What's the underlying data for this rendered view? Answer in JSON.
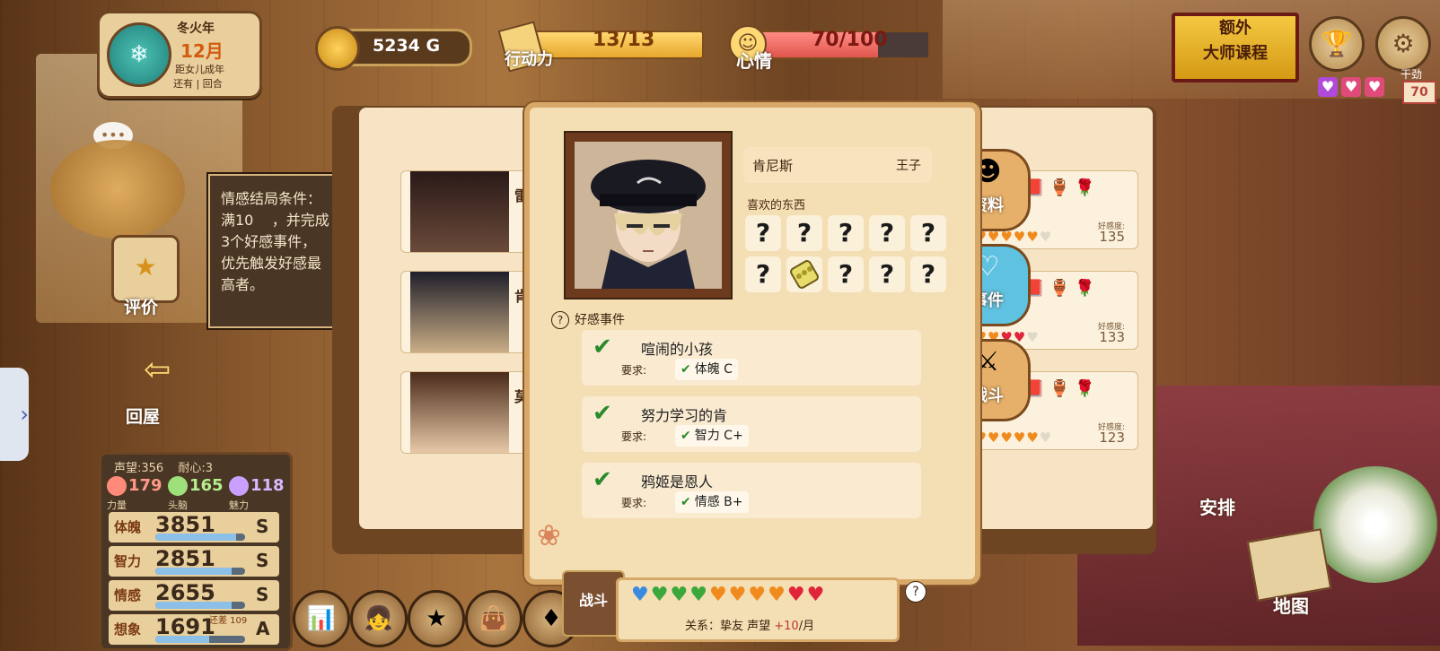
{
  "top": {
    "date": {
      "year": "冬火年",
      "month": "12月",
      "sub1": "距女儿成年",
      "sub2": "还有 | 回合"
    },
    "gold": "5234 G",
    "action_points": {
      "value": "13/13",
      "label": "行动力",
      "fraction": 1.0
    },
    "mood": {
      "value": "70/100",
      "label": "心情",
      "fraction": 0.7
    },
    "course_button": {
      "line1": "额外",
      "line2": "大师课程"
    },
    "interventions": {
      "label": "干劲",
      "value": "70"
    }
  },
  "left": {
    "eval_label": "评价",
    "back_label": "回屋",
    "tooltip": "情感结局条件：\n满10    ，并完成\n3个好感事件，\n优先触发好感最\n高者。"
  },
  "stats": {
    "reputation": "声望:356",
    "patience": "耐心:3",
    "core": [
      {
        "label": "力量",
        "value": "179",
        "color": "#ff8a7a"
      },
      {
        "label": "头脑",
        "value": "165",
        "color": "#9ee07a"
      },
      {
        "label": "魅力",
        "value": "118",
        "color": "#c9a0ff"
      }
    ],
    "attributes": [
      {
        "name": "体魄",
        "value": "3851",
        "grade": "S",
        "fill": 0.9,
        "extra": ""
      },
      {
        "name": "智力",
        "value": "2851",
        "grade": "S",
        "fill": 0.85,
        "extra": ""
      },
      {
        "name": "情感",
        "value": "2655",
        "grade": "S",
        "fill": 0.85,
        "extra": ""
      },
      {
        "name": "想象",
        "value": "1691",
        "grade": "A",
        "fill": 0.6,
        "extra": "还差 109"
      }
    ]
  },
  "book": {
    "left_cards": [
      {
        "name": "雷"
      },
      {
        "name": "肯"
      },
      {
        "name": "莫"
      }
    ],
    "right_cards": [
      {
        "fav_label": "好感度:",
        "fav": "135"
      },
      {
        "fav_label": "好感度:",
        "fav": "133"
      },
      {
        "fav_label": "好感度:",
        "fav": "123"
      }
    ],
    "tabs": [
      {
        "label": "资料",
        "icon": "profile-icon"
      },
      {
        "label": "事件",
        "icon": "heart-icon"
      },
      {
        "label": "战斗",
        "icon": "swords-icon"
      }
    ]
  },
  "popup": {
    "name": "肯尼斯",
    "title": "王子",
    "likes_label": "喜欢的东西",
    "likes": [
      "?",
      "?",
      "?",
      "?",
      "?",
      "?",
      "item",
      "?",
      "?",
      "?"
    ],
    "events_header": "好感事件",
    "events": [
      {
        "name": "喧闹的小孩",
        "req_label": "要求:",
        "req": "体魄 C"
      },
      {
        "name": "努力学习的肯",
        "req_label": "要求:",
        "req": "智力 C+"
      },
      {
        "name": "鸦姬是恩人",
        "req_label": "要求:",
        "req": "情感 B+"
      }
    ]
  },
  "relationship": {
    "hearts": [
      "blue",
      "green",
      "green",
      "green",
      "orange",
      "orange",
      "orange",
      "orange",
      "red",
      "red"
    ],
    "prefix": "关系：挚友   声望 ",
    "plus": "+10",
    "suffix": "/月",
    "fight_label": "战斗"
  },
  "right_labels": {
    "arrange": "安排",
    "map": "地图"
  },
  "colors": {
    "accent_gold": "#f5c842",
    "heart_red": "#e0243a",
    "heart_orange": "#f08a1c",
    "heart_green": "#3aa83a",
    "heart_blue": "#3a8ae0"
  }
}
